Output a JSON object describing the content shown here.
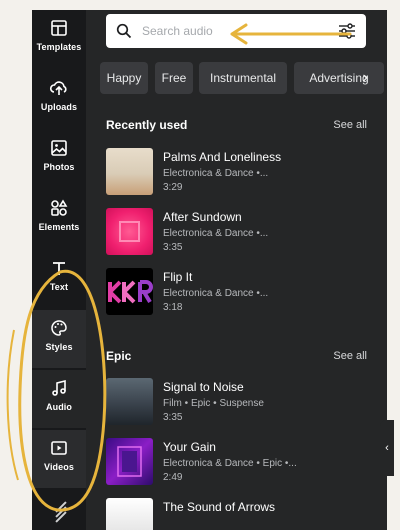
{
  "sidebar": {
    "items": [
      {
        "label": "Templates",
        "icon": "templates-icon"
      },
      {
        "label": "Uploads",
        "icon": "upload-cloud-icon"
      },
      {
        "label": "Photos",
        "icon": "image-icon"
      },
      {
        "label": "Elements",
        "icon": "shapes-icon"
      },
      {
        "label": "Text",
        "icon": "text-icon"
      },
      {
        "label": "Styles",
        "icon": "palette-icon"
      },
      {
        "label": "Audio",
        "icon": "music-note-icon"
      },
      {
        "label": "Videos",
        "icon": "video-icon"
      }
    ],
    "active": "Audio"
  },
  "search": {
    "placeholder": "Search audio"
  },
  "chips": [
    "Happy",
    "Free",
    "Instrumental",
    "Advertising"
  ],
  "sections": [
    {
      "title": "Recently used",
      "see_all": "See all",
      "tracks": [
        {
          "title": "Palms And Loneliness",
          "subtitle": "Electronica & Dance •...",
          "duration": "3:29"
        },
        {
          "title": "After Sundown",
          "subtitle": "Electronica & Dance •...",
          "duration": "3:35"
        },
        {
          "title": "Flip It",
          "subtitle": "Electronica & Dance •...",
          "duration": "3:18"
        }
      ]
    },
    {
      "title": "Epic",
      "see_all": "See all",
      "tracks": [
        {
          "title": "Signal to Noise",
          "subtitle": "Film • Epic • Suspense",
          "duration": "3:35"
        },
        {
          "title": "Your Gain",
          "subtitle": "Electronica & Dance • Epic •...",
          "duration": "2:49"
        },
        {
          "title": "The Sound of Arrows",
          "subtitle": "",
          "duration": ""
        }
      ]
    }
  ],
  "colors": {
    "rail_bg": "#18191b",
    "panel_bg": "#252627",
    "chip_bg": "#3a3b3e",
    "annotation": "#e6b43c"
  }
}
